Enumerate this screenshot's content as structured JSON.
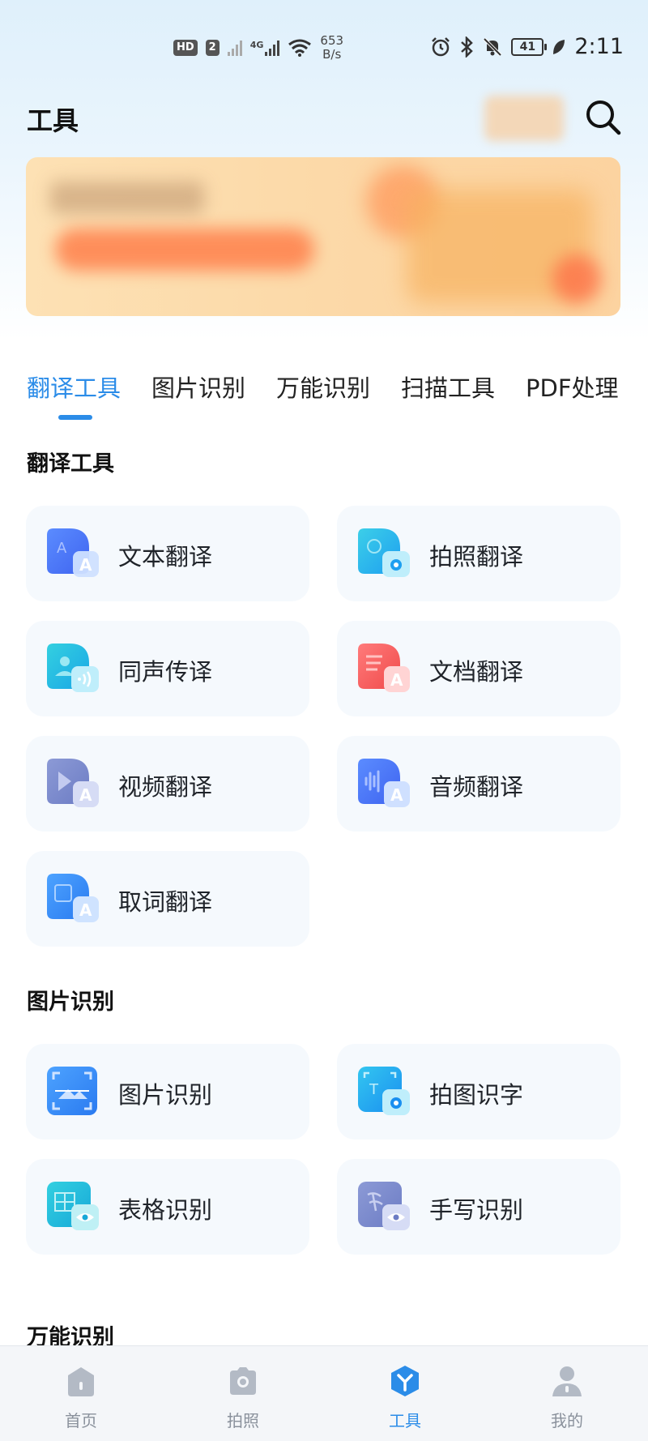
{
  "status_bar": {
    "hd": "HD",
    "sim": "2",
    "net_type": "4G",
    "speed_value": "653",
    "speed_unit": "B/s",
    "battery": "41",
    "time": "2:11"
  },
  "header": {
    "title": "工具"
  },
  "tabs": [
    {
      "label": "翻译工具",
      "active": true
    },
    {
      "label": "图片识别",
      "active": false
    },
    {
      "label": "万能识别",
      "active": false
    },
    {
      "label": "扫描工具",
      "active": false
    },
    {
      "label": "PDF处理",
      "active": false
    }
  ],
  "sections": {
    "translate": {
      "title": "翻译工具",
      "items": [
        {
          "label": "文本翻译",
          "icon": "text-translate-icon"
        },
        {
          "label": "拍照翻译",
          "icon": "photo-translate-icon"
        },
        {
          "label": "同声传译",
          "icon": "simultaneous-interpret-icon"
        },
        {
          "label": "文档翻译",
          "icon": "document-translate-icon"
        },
        {
          "label": "视频翻译",
          "icon": "video-translate-icon"
        },
        {
          "label": "音频翻译",
          "icon": "audio-translate-icon"
        },
        {
          "label": "取词翻译",
          "icon": "word-pick-translate-icon"
        }
      ]
    },
    "image_recognition": {
      "title": "图片识别",
      "items": [
        {
          "label": "图片识别",
          "icon": "image-recognize-icon"
        },
        {
          "label": "拍图识字",
          "icon": "photo-ocr-icon"
        },
        {
          "label": "表格识别",
          "icon": "table-recognize-icon"
        },
        {
          "label": "手写识别",
          "icon": "handwriting-recognize-icon"
        }
      ]
    },
    "universal": {
      "title": "万能识别"
    }
  },
  "bottom_nav": [
    {
      "label": "首页",
      "icon": "home-icon",
      "active": false
    },
    {
      "label": "拍照",
      "icon": "camera-icon",
      "active": false
    },
    {
      "label": "工具",
      "icon": "tools-icon",
      "active": true
    },
    {
      "label": "我的",
      "icon": "profile-icon",
      "active": false
    }
  ],
  "colors": {
    "accent": "#2b8ce8",
    "card_bg": "#f5f9fd",
    "nav_inactive": "#8a919c"
  }
}
